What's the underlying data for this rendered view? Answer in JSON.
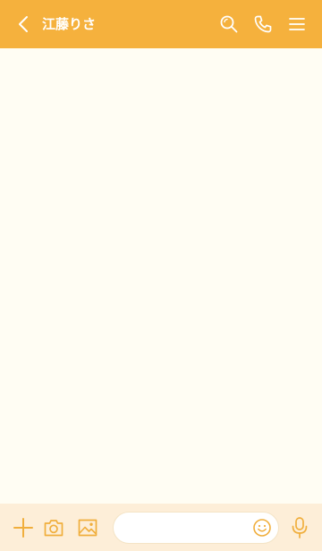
{
  "colors": {
    "header_bg": "#f5b13d",
    "header_fg": "#ffffff",
    "chat_bg": "#fffdf3",
    "bar_bg": "#fdeed8",
    "bar_icon": "#f0ae3c",
    "input_border": "#f4e4c6"
  },
  "header": {
    "back_icon": "chevron-left-icon",
    "title": "江藤りさ",
    "actions": [
      {
        "name": "search",
        "icon": "search-icon"
      },
      {
        "name": "call",
        "icon": "phone-icon"
      },
      {
        "name": "menu",
        "icon": "menu-icon"
      }
    ]
  },
  "input_bar": {
    "actions": [
      {
        "name": "add",
        "icon": "plus-icon"
      },
      {
        "name": "camera",
        "icon": "camera-icon"
      },
      {
        "name": "image",
        "icon": "image-icon"
      }
    ],
    "message_value": "",
    "message_placeholder": "",
    "emoji_icon": "smile-icon",
    "mic_icon": "microphone-icon"
  }
}
